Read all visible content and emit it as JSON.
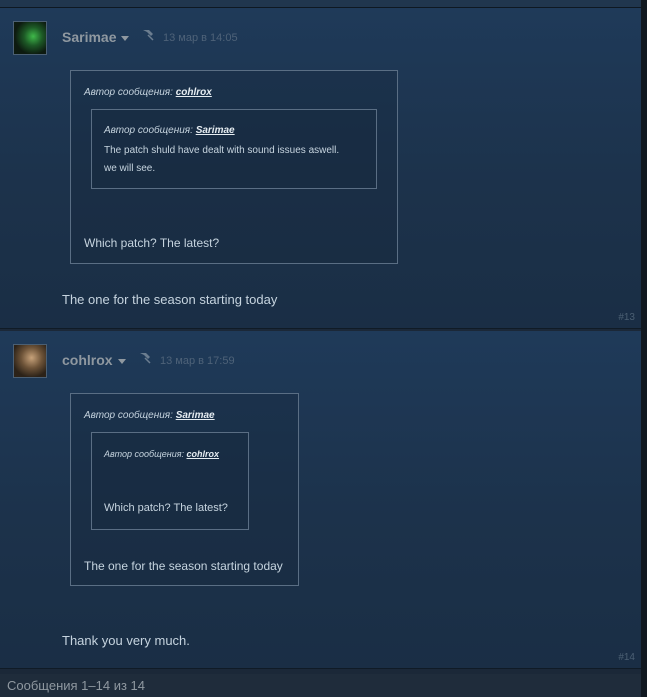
{
  "posts": [
    {
      "author": "Sarimae",
      "date": "13 мар в 14:05",
      "number": "#13",
      "quote": {
        "header_prefix": "Автор сообщения:",
        "header_author": "cohlrox",
        "nested": {
          "header_prefix": "Автор сообщения:",
          "header_author": "Sarimae",
          "lines": [
            "The patch shuld have dealt with sound issues aswell.",
            "we will see."
          ]
        },
        "text": "Which patch? The latest?"
      },
      "body": "The one for the season starting today"
    },
    {
      "author": "cohlrox",
      "date": "13 мар в 17:59",
      "number": "#14",
      "quote": {
        "header_prefix": "Автор сообщения:",
        "header_author": "Sarimae",
        "nested": {
          "header_prefix": "Автор сообщения:",
          "header_author": "cohlrox",
          "text": "Which patch? The latest?"
        },
        "text": "The one for the season starting today"
      },
      "body": "Thank you very much."
    }
  ],
  "footer": "Сообщения 1–14 из 14",
  "icons": {
    "avatar_13": "avatar-image",
    "avatar_14": "avatar-image",
    "pin": "pin-icon",
    "dropdown": "chevron-down-icon"
  }
}
